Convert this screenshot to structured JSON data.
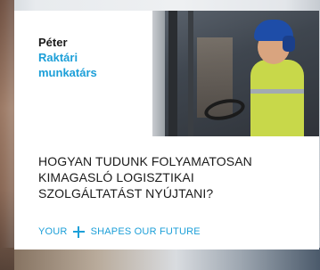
{
  "profile": {
    "name": "Péter",
    "role": "Raktári munkatárs"
  },
  "question": "HOGYAN TUDUNK FOLYAMATOSAN KIMAGASLÓ LOGISZTIKAI SZOLGÁLTATÁST NYÚJTANI?",
  "tagline": {
    "left": "YOUR",
    "icon": "plus-icon",
    "right": "SHAPES OUR FUTURE"
  },
  "colors": {
    "accent": "#1c9fd8",
    "text": "#1a1a1a",
    "card": "#ffffff"
  }
}
